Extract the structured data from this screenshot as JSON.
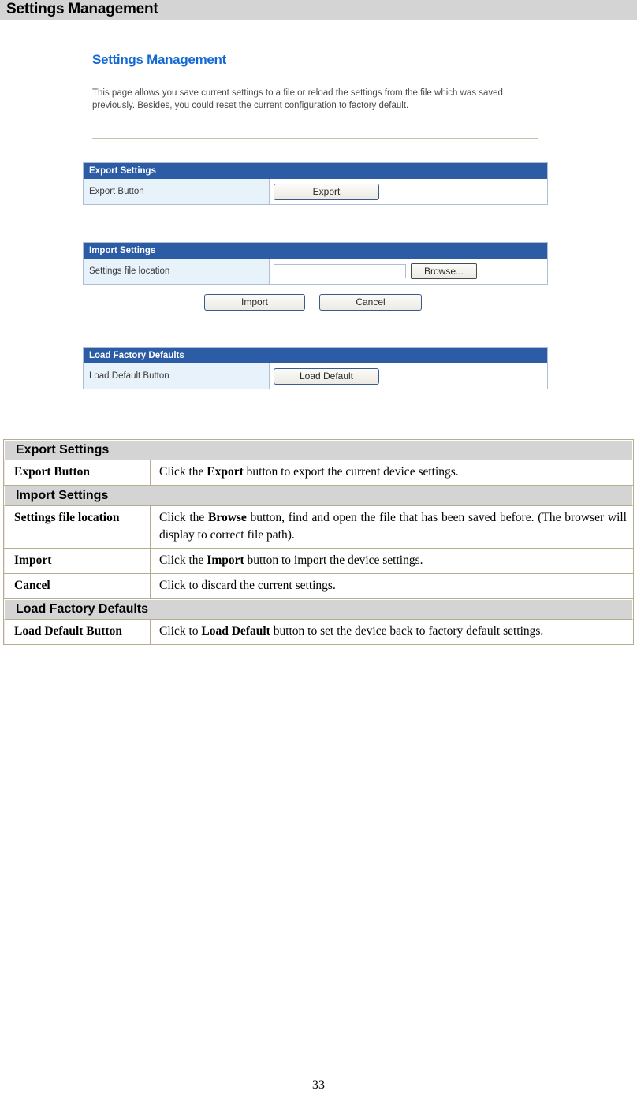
{
  "header": {
    "title": "Settings Management"
  },
  "device_screenshot": {
    "title": "Settings Management",
    "description": "This page allows you save current settings to a file or reload the settings from the file which was saved previously. Besides, you could reset the current configuration to factory default.",
    "export_panel": {
      "heading": "Export Settings",
      "row_label": "Export Button",
      "export_button": "Export"
    },
    "import_panel": {
      "heading": "Import Settings",
      "row_label": "Settings file location",
      "file_input_value": "",
      "browse_button": "Browse...",
      "import_button": "Import",
      "cancel_button": "Cancel"
    },
    "defaults_panel": {
      "heading": "Load Factory Defaults",
      "row_label": "Load Default Button",
      "load_default_button": "Load Default"
    }
  },
  "doc_table": {
    "sections": [
      {
        "heading": "Export Settings",
        "rows": [
          {
            "key": "Export Button",
            "value_prefix": "Click the ",
            "value_bold": "Export",
            "value_suffix": " button to export the current device settings."
          }
        ]
      },
      {
        "heading": "Import Settings",
        "rows": [
          {
            "key": "Settings file location",
            "value_prefix": "Click the ",
            "value_bold": "Browse",
            "value_suffix": " button, find and open the file that has been saved before. (The browser will display to correct file path)."
          },
          {
            "key": "Import",
            "value_prefix": "Click the ",
            "value_bold": "Import",
            "value_suffix": " button to import the device settings."
          },
          {
            "key": "Cancel",
            "value_prefix": "Click to discard the current settings.",
            "value_bold": "",
            "value_suffix": ""
          }
        ]
      },
      {
        "heading": "Load Factory Defaults",
        "rows": [
          {
            "key": "Load Default Button",
            "value_prefix": "Click to ",
            "value_bold": "Load Default",
            "value_suffix": " button to set the device back to factory default settings."
          }
        ]
      }
    ]
  },
  "footer": {
    "page_number": "33"
  },
  "colors": {
    "header_band": "#d4d4d4",
    "panel_blue": "#2d5ca6",
    "shot_title_blue": "#1569d4",
    "row_label_bg": "#e8f2fb",
    "table_border": "#b5ad8e"
  }
}
